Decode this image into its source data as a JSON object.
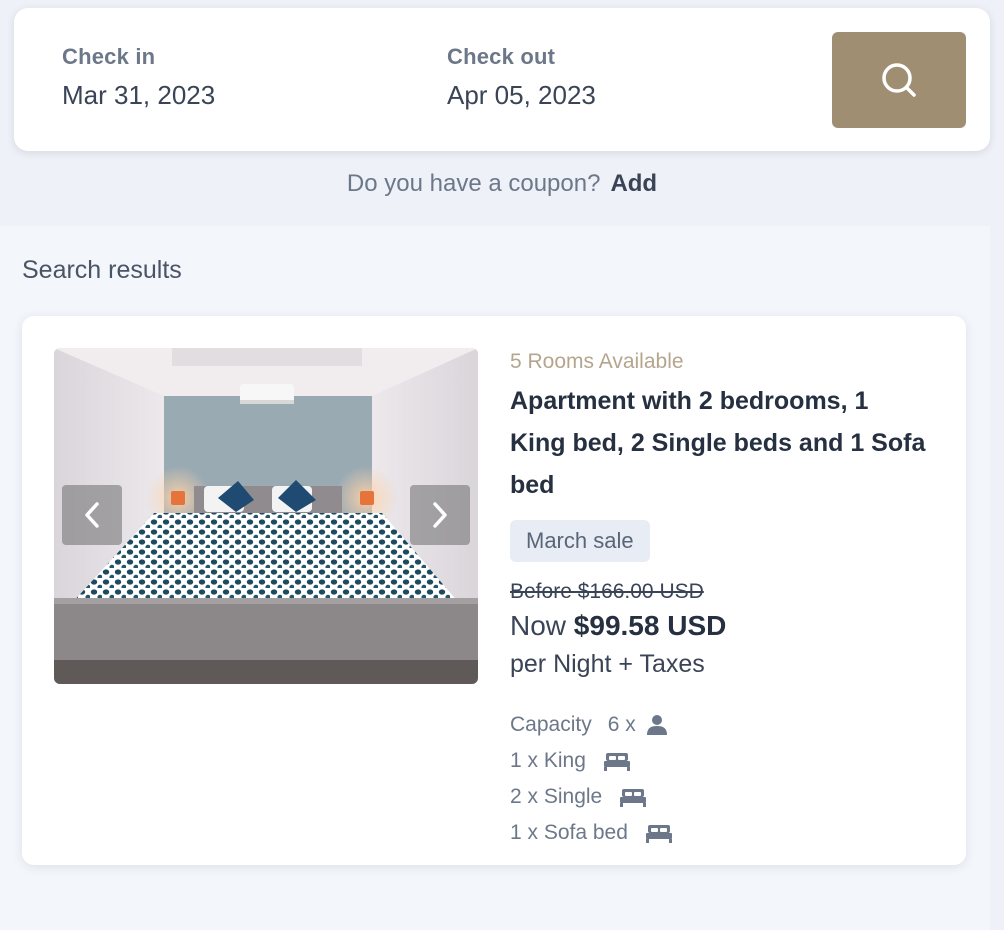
{
  "search_bar": {
    "check_in_label": "Check in",
    "check_in_value": "Mar 31, 2023",
    "check_out_label": "Check out",
    "check_out_value": "Apr 05, 2023",
    "search_icon": "search-icon",
    "accent_color": "#a08e73"
  },
  "coupon": {
    "question": "Do you have a coupon?",
    "add_label": "Add"
  },
  "results": {
    "title": "Search results",
    "room": {
      "availability": "5 Rooms Available",
      "name": "Apartment with 2 bedrooms, 1 King bed, 2 Single beds and 1 Sofa bed",
      "badge": "March sale",
      "price_before": "Before $166.00 USD",
      "price_now_prefix": "Now",
      "price_now_amount": "$99.58 USD",
      "price_note": "per Night + Taxes",
      "capacity_label": "Capacity",
      "capacity_value": "6 x",
      "beds": [
        {
          "label": "1 x King",
          "icon": "bed-icon"
        },
        {
          "label": "2 x Single",
          "icon": "bed-icon"
        },
        {
          "label": "1 x Sofa bed",
          "icon": "bed-icon"
        }
      ],
      "image_icons": {
        "prev": "chevron-left-icon",
        "next": "chevron-right-icon"
      }
    }
  }
}
